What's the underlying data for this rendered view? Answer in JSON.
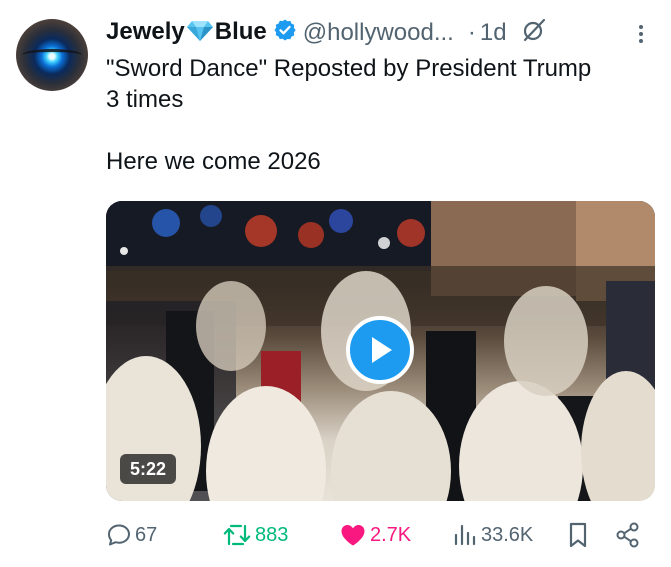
{
  "author": {
    "name_part1": "Jewely",
    "name_part2": "Blue",
    "handle": "@hollywood...",
    "separator": "·",
    "time": "1d"
  },
  "tweet": {
    "line1": "\"Sword Dance\"  Reposted by President Trump",
    "line2": "3 times",
    "line3": "Here we come 2026"
  },
  "media": {
    "duration": "5:22"
  },
  "actions": {
    "replies": "67",
    "reposts": "883",
    "likes": "2.7K",
    "views": "33.6K"
  },
  "colors": {
    "accent": "#1d9bf0",
    "repost_active": "#00ba7c",
    "like_active": "#f91880",
    "muted": "#536471",
    "text": "#0f1419"
  },
  "icons": [
    "gem-icon",
    "verified-badge-icon",
    "grok-icon",
    "more-icon",
    "play-icon",
    "reply-icon",
    "repost-icon",
    "heart-icon",
    "views-icon",
    "bookmark-icon",
    "share-icon"
  ]
}
